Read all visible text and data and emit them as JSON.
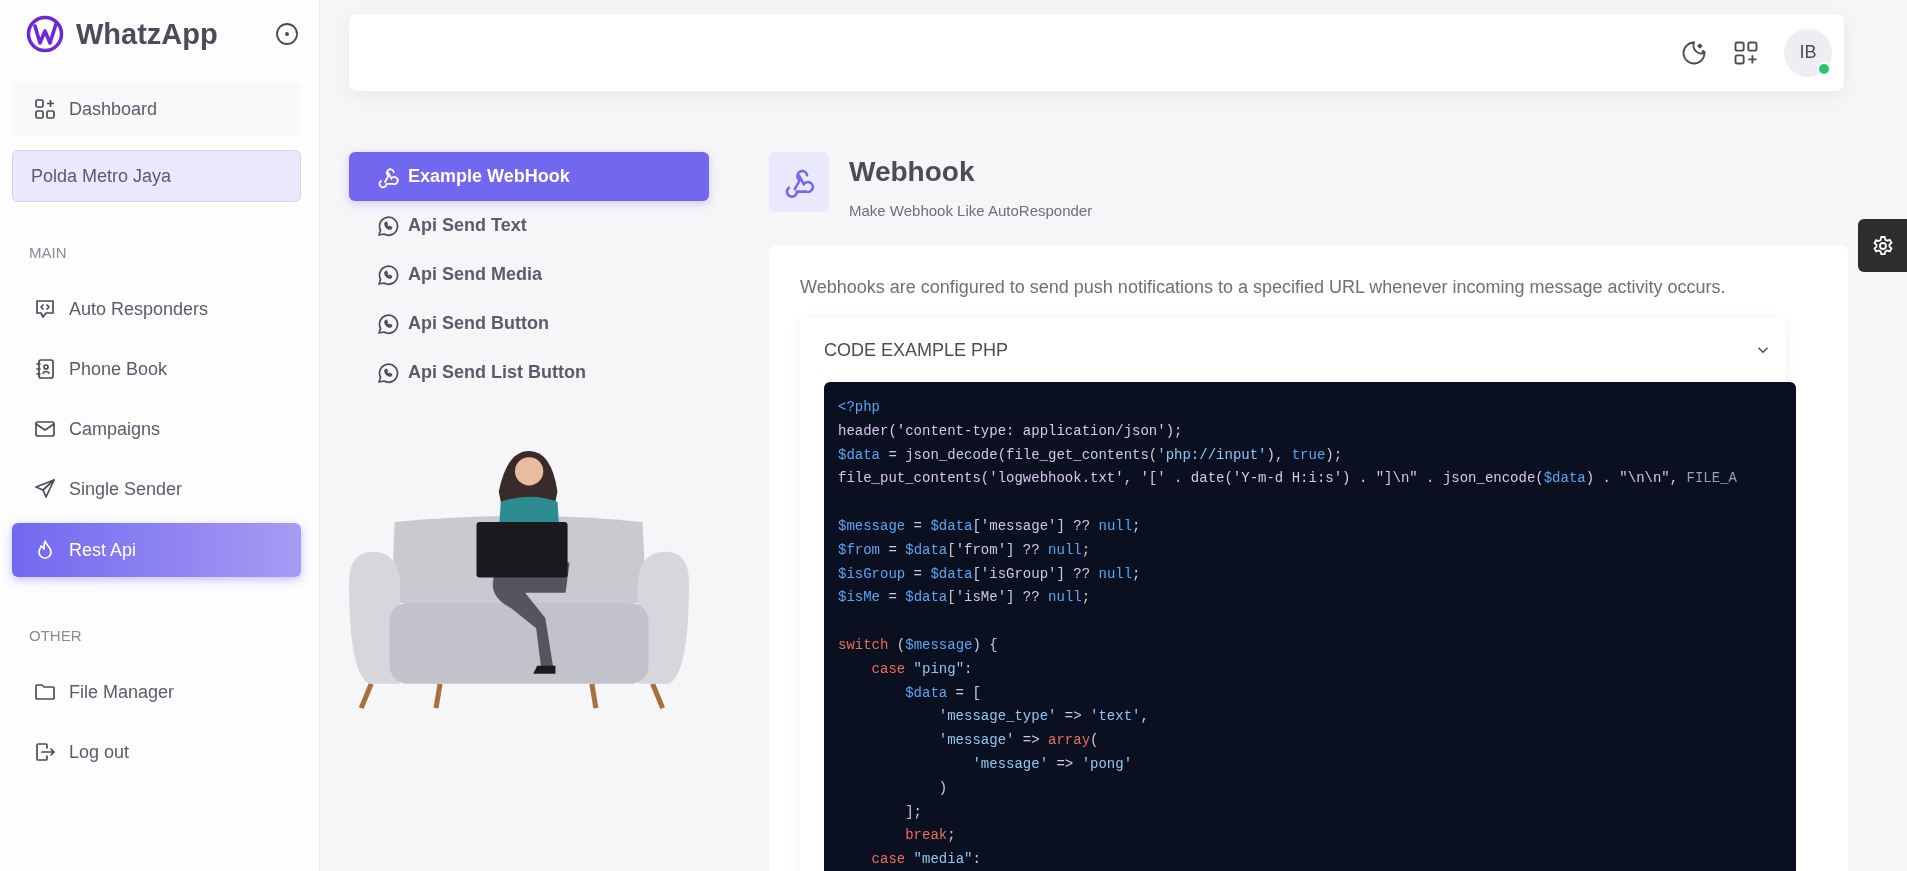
{
  "brand": {
    "name": "WhatzApp"
  },
  "sidebar": {
    "top_item": {
      "label": "Dashboard"
    },
    "device": {
      "label": "Polda Metro Jaya"
    },
    "sections": [
      {
        "title": "MAIN",
        "items": [
          {
            "label": "Auto Responders",
            "selected": false
          },
          {
            "label": "Phone Book",
            "selected": false
          },
          {
            "label": "Campaigns",
            "selected": false
          },
          {
            "label": "Single Sender",
            "selected": false
          },
          {
            "label": "Rest Api",
            "selected": true
          }
        ]
      },
      {
        "title": "OTHER",
        "items": [
          {
            "label": "File Manager",
            "selected": false
          },
          {
            "label": "Log out",
            "selected": false
          }
        ]
      }
    ]
  },
  "header": {
    "avatar": {
      "initials": "IB",
      "online": true
    }
  },
  "api_menu": [
    {
      "label": "Example WebHook",
      "selected": true
    },
    {
      "label": "Api Send Text",
      "selected": false
    },
    {
      "label": "Api Send Media",
      "selected": false
    },
    {
      "label": "Api Send Button",
      "selected": false
    },
    {
      "label": "Api Send List Button",
      "selected": false
    }
  ],
  "page": {
    "title": "Webhook",
    "subtitle": "Make Webhook Like AutoResponder",
    "description": "Webhooks are configured to send push notifications to a specified URL whenever incoming message activity occurs."
  },
  "accordion": {
    "title": "CODE EXAMPLE PHP",
    "expanded": true,
    "code": [
      {
        "kind": "code",
        "tokens": [
          {
            "kind": "var",
            "text": "<?php"
          }
        ]
      },
      {
        "kind": "code",
        "tokens": [
          {
            "kind": "fn",
            "text": "header('content-type: application/json');"
          }
        ]
      },
      {
        "kind": "code",
        "tokens": [
          {
            "kind": "var",
            "text": "$data"
          },
          {
            "kind": "plain",
            "text": " = json_decode(file_get_contents("
          },
          {
            "kind": "str",
            "text": "'php://input'"
          },
          {
            "kind": "plain",
            "text": "), "
          },
          {
            "kind": "var",
            "text": "true"
          },
          {
            "kind": "plain",
            "text": ");"
          }
        ]
      },
      {
        "kind": "code",
        "tokens": [
          {
            "kind": "fn",
            "text": "file_put_contents('logwebhook.txt', '[' . date('Y-m-d H:i:s') . \"]\\n\" . json_encode("
          },
          {
            "kind": "var",
            "text": "$data"
          },
          {
            "kind": "fn",
            "text": ") . \"\\n\\n\","
          },
          {
            "kind": "dim",
            "text": " FILE_A"
          }
        ]
      },
      {
        "kind": "blank"
      },
      {
        "kind": "code",
        "tokens": [
          {
            "kind": "var",
            "text": "$message"
          },
          {
            "kind": "plain",
            "text": " = "
          },
          {
            "kind": "var",
            "text": "$data"
          },
          {
            "kind": "plain",
            "text": "['message'] ?? "
          },
          {
            "kind": "var",
            "text": "null"
          },
          {
            "kind": "plain",
            "text": ";"
          }
        ]
      },
      {
        "kind": "code",
        "tokens": [
          {
            "kind": "var",
            "text": "$from"
          },
          {
            "kind": "plain",
            "text": " = "
          },
          {
            "kind": "var",
            "text": "$data"
          },
          {
            "kind": "plain",
            "text": "['from'] ?? "
          },
          {
            "kind": "var",
            "text": "null"
          },
          {
            "kind": "plain",
            "text": ";"
          }
        ]
      },
      {
        "kind": "code",
        "tokens": [
          {
            "kind": "var",
            "text": "$isGroup"
          },
          {
            "kind": "plain",
            "text": " = "
          },
          {
            "kind": "var",
            "text": "$data"
          },
          {
            "kind": "plain",
            "text": "['isGroup'] ?? "
          },
          {
            "kind": "var",
            "text": "null"
          },
          {
            "kind": "plain",
            "text": ";"
          }
        ]
      },
      {
        "kind": "code",
        "tokens": [
          {
            "kind": "var",
            "text": "$isMe"
          },
          {
            "kind": "plain",
            "text": " = "
          },
          {
            "kind": "var",
            "text": "$data"
          },
          {
            "kind": "plain",
            "text": "['isMe'] ?? "
          },
          {
            "kind": "var",
            "text": "null"
          },
          {
            "kind": "plain",
            "text": ";"
          }
        ]
      },
      {
        "kind": "blank"
      },
      {
        "kind": "code",
        "tokens": [
          {
            "kind": "kw",
            "text": "switch"
          },
          {
            "kind": "plain",
            "text": " ("
          },
          {
            "kind": "var",
            "text": "$message"
          },
          {
            "kind": "plain",
            "text": ") {"
          }
        ]
      },
      {
        "kind": "code",
        "tokens": [
          {
            "kind": "kw",
            "text": "    case"
          },
          {
            "kind": "str",
            "text": " \"ping\""
          },
          {
            "kind": "plain",
            "text": ":"
          }
        ]
      },
      {
        "kind": "code",
        "tokens": [
          {
            "kind": "var",
            "text": "        $data"
          },
          {
            "kind": "plain",
            "text": " = ["
          }
        ]
      },
      {
        "kind": "code",
        "tokens": [
          {
            "kind": "str",
            "text": "            'message_type'"
          },
          {
            "kind": "plain",
            "text": " => "
          },
          {
            "kind": "str",
            "text": "'text'"
          },
          {
            "kind": "plain",
            "text": ","
          }
        ]
      },
      {
        "kind": "code",
        "tokens": [
          {
            "kind": "str",
            "text": "            'message'"
          },
          {
            "kind": "plain",
            "text": " => "
          },
          {
            "kind": "kw",
            "text": "array"
          },
          {
            "kind": "plain",
            "text": "("
          }
        ]
      },
      {
        "kind": "code",
        "tokens": [
          {
            "kind": "str",
            "text": "                'message'"
          },
          {
            "kind": "plain",
            "text": " => "
          },
          {
            "kind": "str",
            "text": "'pong'"
          }
        ]
      },
      {
        "kind": "code",
        "tokens": [
          {
            "kind": "plain",
            "text": "            )"
          }
        ]
      },
      {
        "kind": "code",
        "tokens": [
          {
            "kind": "plain",
            "text": "        ];"
          }
        ]
      },
      {
        "kind": "code",
        "tokens": [
          {
            "kind": "kw",
            "text": "        break"
          },
          {
            "kind": "plain",
            "text": ";"
          }
        ]
      },
      {
        "kind": "code",
        "tokens": [
          {
            "kind": "kw",
            "text": "    case"
          },
          {
            "kind": "str",
            "text": " \"media\""
          },
          {
            "kind": "plain",
            "text": ":"
          }
        ]
      }
    ]
  }
}
